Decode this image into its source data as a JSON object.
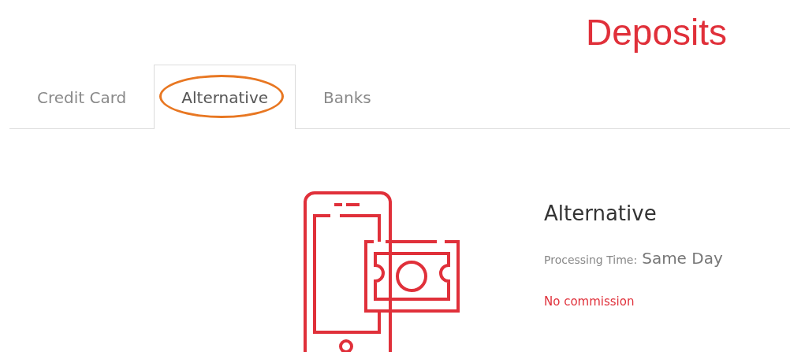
{
  "page_title": "Deposits",
  "tabs": [
    {
      "label": "Credit Card",
      "selected": false,
      "highlighted": false
    },
    {
      "label": "Alternative",
      "selected": true,
      "highlighted": true
    },
    {
      "label": "Banks",
      "selected": false,
      "highlighted": false
    }
  ],
  "method": {
    "title": "Alternative",
    "processing_label": "Processing Time:",
    "processing_value": "Same Day",
    "commission": "No commission"
  }
}
